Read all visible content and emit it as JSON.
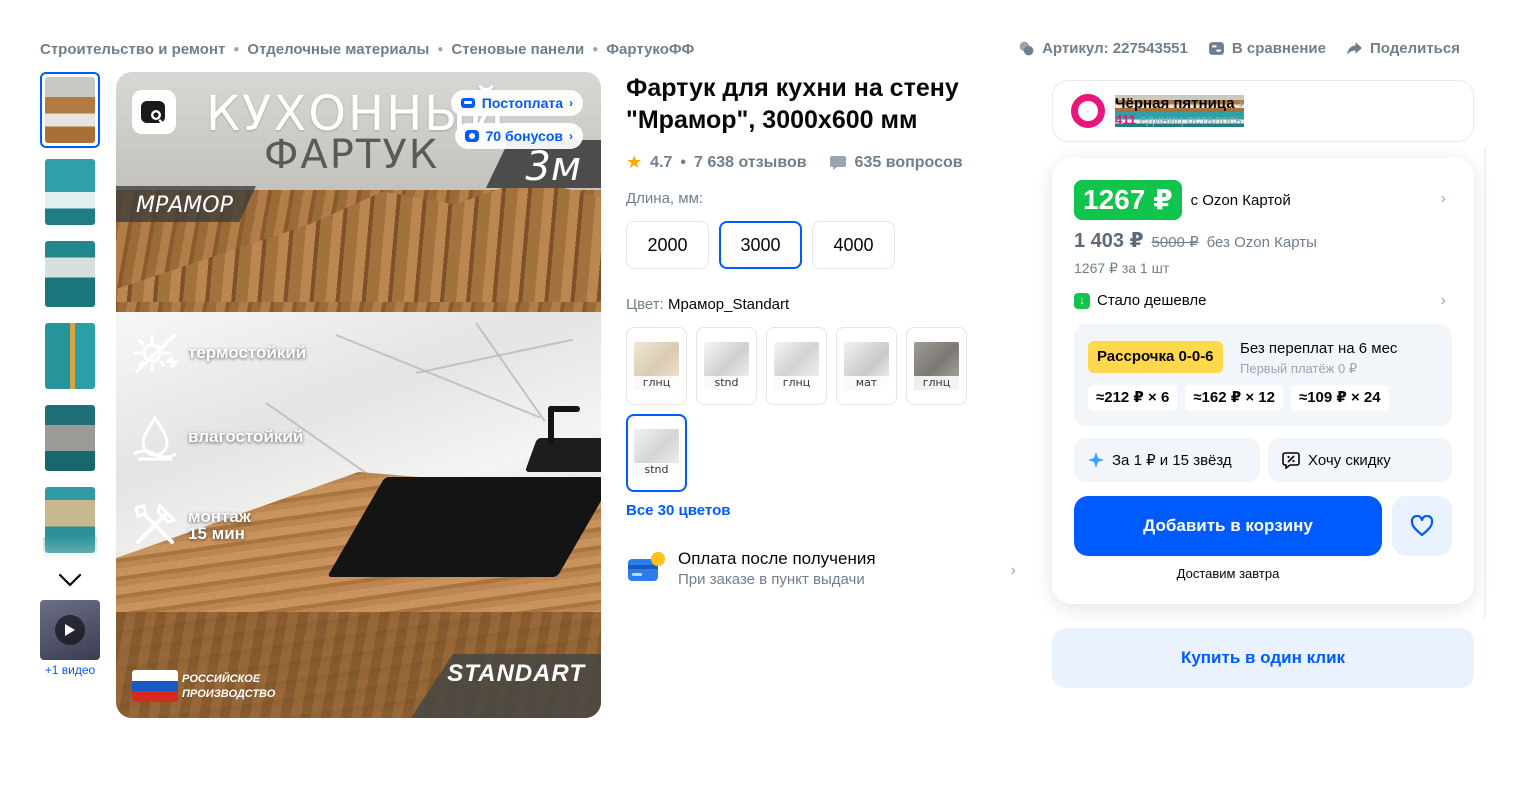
{
  "breadcrumbs": [
    "Строительство и ремонт",
    "Отделочные материалы",
    "Стеновые панели",
    "ФартукоФФ"
  ],
  "top_actions": {
    "article": "Артикул: 227543551",
    "compare": "В сравнение",
    "share": "Поделиться"
  },
  "gallery": {
    "thumbnail_count": 6,
    "video_label": "+1 видео",
    "main": {
      "title_line1": "КУХОННЫЙ",
      "title_line2": "ФАРТУК",
      "length_badge": "3м",
      "design": "МРАМОР",
      "features": [
        "термостойкий",
        "влагостойкий",
        "монтаж",
        "15 мин"
      ],
      "origin_line1": "РОССИЙСКОЕ",
      "origin_line2": "ПРОИЗВОДСТВО",
      "series": "STANDART",
      "pill_postpay": "Постоплата",
      "pill_bonus": "70 бонусов"
    }
  },
  "product": {
    "title": "Фартук для кухни на стену \"Мрамор\", 3000х600 мм",
    "rating": "4.7",
    "reviews": "7 638 отзывов",
    "questions": "635 вопросов",
    "length_label": "Длина, мм:",
    "lengths": [
      "2000",
      "3000",
      "4000"
    ],
    "selected_length": "3000",
    "color_label": "Цвет:",
    "color_value": "Мрамор_Standart",
    "swatches": [
      "глнц",
      "stnd",
      "глнц",
      "мат",
      "глнц",
      "stnd"
    ],
    "all_colors": "Все 30 цветов",
    "payment_title": "Оплата после получения",
    "payment_sub": "При заказе в пункт выдачи"
  },
  "promo": {
    "title": "Чёрная пятница",
    "count": "411",
    "count_suffix": "единиц осталось"
  },
  "buybox": {
    "price_card": "1267 ₽",
    "price_card_label": "с Ozon Картой",
    "price_regular": "1 403 ₽",
    "price_old": "5000 ₽",
    "price_regular_label": "без Ozon Карты",
    "per_unit": "1267 ₽ за 1 шт",
    "cheaper": "Стало дешевле",
    "installment_badge": "Рассрочка 0-0-6",
    "installment_title": "Без переплат на 6 мес",
    "installment_sub": "Первый платёж 0 ₽",
    "plans": [
      "≈212 ₽ × 6",
      "≈162 ₽ × 12",
      "≈109 ₽ × 24"
    ],
    "stars_button": "За 1 ₽ и 15 звёзд",
    "discount_button": "Хочу скидку",
    "add_to_cart": "Добавить в корзину",
    "delivery": "Доставим завтра",
    "one_click": "Купить в один клик"
  },
  "colors": {
    "accent": "#005bff",
    "price_green": "#10c44c",
    "installment_yellow": "#ffd84c",
    "promo_pink": "#e8157b"
  }
}
